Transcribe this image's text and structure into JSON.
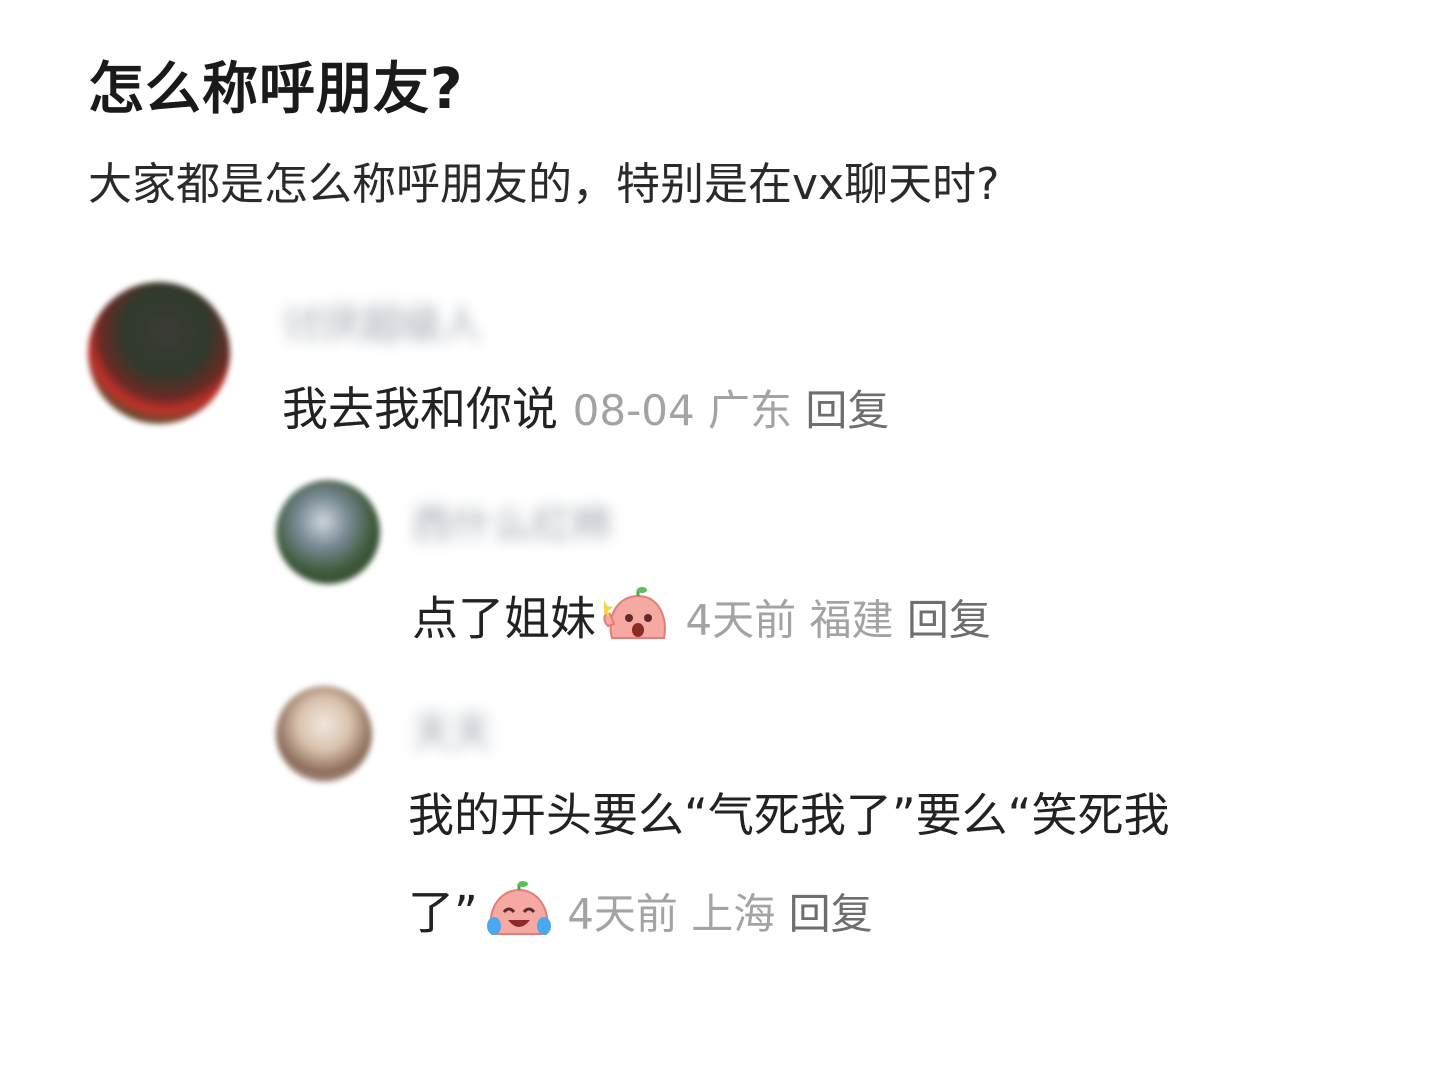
{
  "post": {
    "title": "怎么称呼朋友?",
    "body": "大家都是怎么称呼朋友的，特别是在vx聊天时?"
  },
  "comments": [
    {
      "username": "讨厌超级人",
      "content": "我去我和你说",
      "date": "08-04",
      "location": "广东",
      "reply_label": "回复"
    },
    {
      "username": "西什么红柿",
      "content": "点了姐妹",
      "sticker": "surprised-blob-emoji",
      "date": "4天前",
      "location": "福建",
      "reply_label": "回复"
    },
    {
      "username": "天天",
      "content_line1": "我的开头要么“气死我了”要么“笑死我",
      "content_line2": "了”",
      "sticker": "laughing-crying-blob-emoji",
      "date": "4天前",
      "location": "上海",
      "reply_label": "回复"
    }
  ],
  "colors": {
    "text": "#222222",
    "meta": "#a3a3a3",
    "reply": "#6e6e6e",
    "sticker_skin": "#f6a8a2"
  }
}
